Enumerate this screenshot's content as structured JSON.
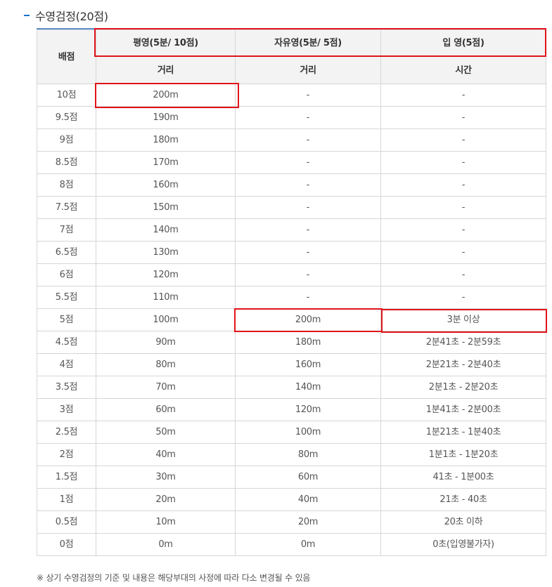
{
  "section": {
    "title": "수영검정(20점)"
  },
  "table": {
    "headers": {
      "grade": "배점",
      "col1_title": "평영(5분/ 10점)",
      "col2_title": "자유영(5분/ 5점)",
      "col3_title": "입 영(5점)",
      "col1_sub": "거리",
      "col2_sub": "거리",
      "col3_sub": "시간"
    },
    "rows": [
      {
        "grade": "10점",
        "c1": "200m",
        "c2": "-",
        "c3": "-"
      },
      {
        "grade": "9.5점",
        "c1": "190m",
        "c2": "-",
        "c3": "-"
      },
      {
        "grade": "9점",
        "c1": "180m",
        "c2": "-",
        "c3": "-"
      },
      {
        "grade": "8.5점",
        "c1": "170m",
        "c2": "-",
        "c3": "-"
      },
      {
        "grade": "8점",
        "c1": "160m",
        "c2": "-",
        "c3": "-"
      },
      {
        "grade": "7.5점",
        "c1": "150m",
        "c2": "-",
        "c3": "-"
      },
      {
        "grade": "7점",
        "c1": "140m",
        "c2": "-",
        "c3": "-"
      },
      {
        "grade": "6.5점",
        "c1": "130m",
        "c2": "-",
        "c3": "-"
      },
      {
        "grade": "6점",
        "c1": "120m",
        "c2": "-",
        "c3": "-"
      },
      {
        "grade": "5.5점",
        "c1": "110m",
        "c2": "-",
        "c3": "-"
      },
      {
        "grade": "5점",
        "c1": "100m",
        "c2": "200m",
        "c3": "3분 이상"
      },
      {
        "grade": "4.5점",
        "c1": "90m",
        "c2": "180m",
        "c3": "2분41초 - 2분59초"
      },
      {
        "grade": "4점",
        "c1": "80m",
        "c2": "160m",
        "c3": "2분21초 - 2분40초"
      },
      {
        "grade": "3.5점",
        "c1": "70m",
        "c2": "140m",
        "c3": "2분1초 - 2분20초"
      },
      {
        "grade": "3점",
        "c1": "60m",
        "c2": "120m",
        "c3": "1분41초 - 2분00초"
      },
      {
        "grade": "2.5점",
        "c1": "50m",
        "c2": "100m",
        "c3": "1분21초 - 1분40초"
      },
      {
        "grade": "2점",
        "c1": "40m",
        "c2": "80m",
        "c3": "1분1초 - 1분20초"
      },
      {
        "grade": "1.5점",
        "c1": "30m",
        "c2": "60m",
        "c3": "41초 - 1분00초"
      },
      {
        "grade": "1점",
        "c1": "20m",
        "c2": "40m",
        "c3": "21초 - 40초"
      },
      {
        "grade": "0.5점",
        "c1": "10m",
        "c2": "20m",
        "c3": "20초 이하"
      },
      {
        "grade": "0점",
        "c1": "0m",
        "c2": "0m",
        "c3": "0초(입영불가자)"
      }
    ]
  },
  "note": "※ 상기 수영검정의 기준 및 내용은 해당부대의 사정에 따라 다소 변경될 수 있음",
  "colors": {
    "accent": "#1a73c9",
    "highlight": "#e0141b",
    "header_bg": "#f3f3f3",
    "border": "#d6d6d6"
  }
}
